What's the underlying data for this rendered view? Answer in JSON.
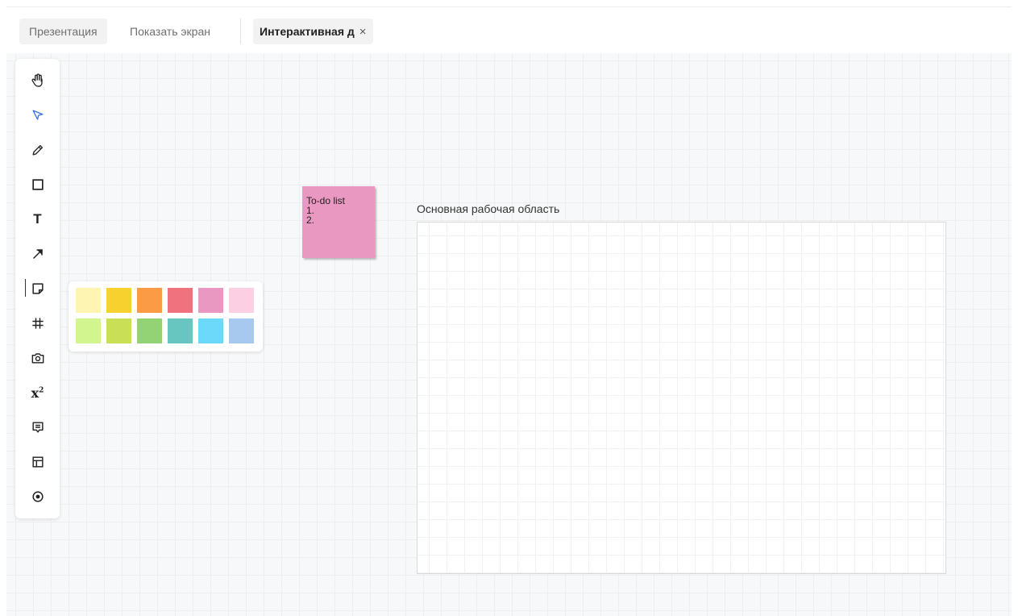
{
  "tabs": {
    "presentation": "Презентация",
    "share_screen": "Показать экран",
    "active": "Интерактивная д",
    "close_symbol": "×"
  },
  "toolbar": {
    "tools": [
      {
        "name": "hand-icon",
        "label": "hand"
      },
      {
        "name": "select-icon",
        "label": "select",
        "color": "#3b6fe0"
      },
      {
        "name": "pencil-icon",
        "label": "pencil"
      },
      {
        "name": "rectangle-icon",
        "label": "rectangle"
      },
      {
        "name": "text-icon",
        "label": "T"
      },
      {
        "name": "arrow-icon",
        "label": "arrow"
      },
      {
        "name": "sticky-note-icon",
        "label": "sticky note"
      },
      {
        "name": "grid-icon",
        "label": "frame"
      },
      {
        "name": "camera-icon",
        "label": "camera"
      },
      {
        "name": "formula-icon",
        "label": "x²"
      },
      {
        "name": "comment-icon",
        "label": "comment"
      },
      {
        "name": "template-icon",
        "label": "template"
      },
      {
        "name": "record-icon",
        "label": "record"
      }
    ],
    "text_tool_glyph": "T",
    "formula_glyph": "x",
    "formula_sup": "2"
  },
  "palette": {
    "colors": [
      "#fff5b3",
      "#f7d12e",
      "#fb9b46",
      "#f0727f",
      "#e998c1",
      "#fccfe3",
      "#d3f58f",
      "#c9df56",
      "#93d275",
      "#67c6c0",
      "#6cd8fa",
      "#a7c9f0"
    ]
  },
  "sticky_note": {
    "color": "#e998c1",
    "line1": "To-do list",
    "line2": "1.",
    "line3": "2."
  },
  "workarea": {
    "label": "Основная рабочая область"
  }
}
